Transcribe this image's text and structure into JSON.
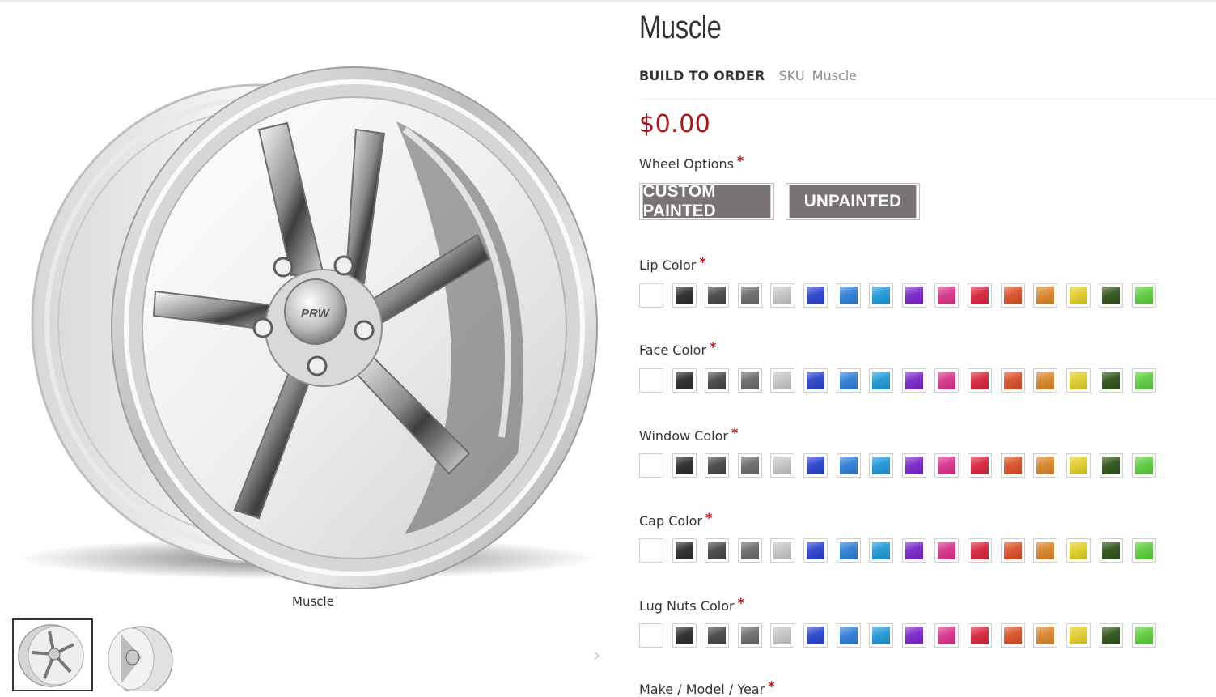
{
  "product": {
    "title": "Muscle",
    "stock_status": "BUILD TO ORDER",
    "sku_label": "SKU",
    "sku_value": "Muscle",
    "price": "$0.00",
    "image_caption": "Muscle",
    "required_marker": "*"
  },
  "wheel_options": {
    "label": "Wheel Options",
    "buttons": [
      "CUSTOM PAINTED",
      "UNPAINTED"
    ]
  },
  "color_options": [
    {
      "label": "Lip Color"
    },
    {
      "label": "Face Color"
    },
    {
      "label": "Window Color"
    },
    {
      "label": "Cap Color"
    },
    {
      "label": "Lug Nuts Color"
    }
  ],
  "next_option_label": "Make / Model / Year",
  "swatch_colors": [
    "#ffffff",
    "#2b2b2b",
    "#474747",
    "#6b6b6b",
    "#c4c4c4",
    "#2a43cc",
    "#2f7ed6",
    "#1f98d4",
    "#7a26c8",
    "#d9338a",
    "#d7263d",
    "#d9502a",
    "#d8852a",
    "#e0cd2a",
    "#2e5418",
    "#5ccd3c"
  ],
  "swatch_names": [
    "white-swatch",
    "black-swatch",
    "dark-gray-swatch",
    "gray-swatch",
    "silver-swatch",
    "blue-swatch",
    "sky-blue-swatch",
    "cyan-swatch",
    "purple-swatch",
    "pink-swatch",
    "red-swatch",
    "orange-swatch",
    "amber-swatch",
    "yellow-swatch",
    "dark-green-swatch",
    "green-swatch"
  ],
  "icons": {
    "gallery_next": "chevron-right-icon"
  },
  "colors": {
    "price": "#b3121b",
    "required": "#c0131b",
    "option_button": "#7a7374"
  }
}
